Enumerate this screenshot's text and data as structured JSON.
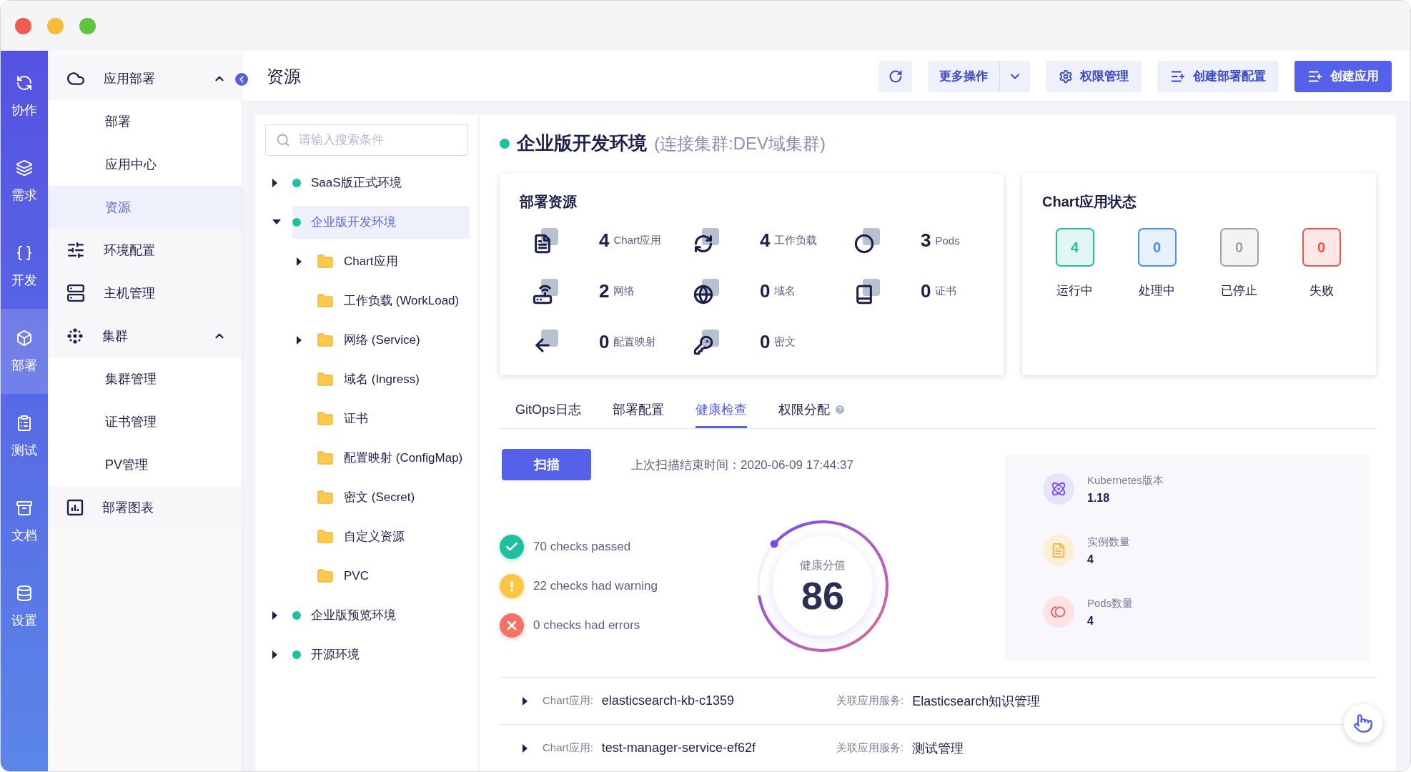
{
  "rail": {
    "items": [
      {
        "label": "协作",
        "selected": false
      },
      {
        "label": "需求",
        "selected": false
      },
      {
        "label": "开发",
        "selected": false
      },
      {
        "label": "部署",
        "selected": true
      },
      {
        "label": "测试",
        "selected": false
      },
      {
        "label": "文档",
        "selected": false
      },
      {
        "label": "设置",
        "selected": false
      }
    ]
  },
  "sidebar": {
    "items": [
      {
        "label": "应用部署",
        "selected": false,
        "expanded": true,
        "children": [
          {
            "label": "部署",
            "selected": false
          },
          {
            "label": "应用中心",
            "selected": false
          },
          {
            "label": "资源",
            "selected": true
          }
        ]
      },
      {
        "label": "环境配置",
        "selected": false
      },
      {
        "label": "主机管理",
        "selected": false
      },
      {
        "label": "集群",
        "selected": false,
        "expanded": true,
        "children": [
          {
            "label": "集群管理",
            "selected": false
          },
          {
            "label": "证书管理",
            "selected": false
          },
          {
            "label": "PV管理",
            "selected": false
          }
        ]
      },
      {
        "label": "部署图表",
        "selected": false
      }
    ]
  },
  "header": {
    "title": "资源",
    "buttons": [
      {
        "kind": "refresh"
      },
      {
        "kind": "dropdown",
        "label": "更多操作"
      },
      {
        "kind": "settings",
        "label": "权限管理"
      },
      {
        "kind": "create",
        "label": "创建部署配置"
      },
      {
        "kind": "primary",
        "label": "创建应用"
      }
    ]
  },
  "tree": {
    "search": {
      "placeholder": "请输入搜索条件"
    },
    "nodes": [
      {
        "label": "SaaS版正式环境",
        "selected": false,
        "expanded": false
      },
      {
        "label": "企业版开发环境",
        "selected": true,
        "expanded": true,
        "children": [
          {
            "label": "Chart应用",
            "selected": false,
            "expanded": false
          },
          {
            "label": "工作负载 (WorkLoad)",
            "selected": false
          },
          {
            "label": "网络 (Service)",
            "selected": false,
            "expanded": false
          },
          {
            "label": "域名 (Ingress)",
            "selected": false
          },
          {
            "label": "证书",
            "selected": false
          },
          {
            "label": "配置映射 (ConfigMap)",
            "selected": false
          },
          {
            "label": "密文 (Secret)",
            "selected": false
          },
          {
            "label": "自定义资源",
            "selected": false
          },
          {
            "label": "PVC",
            "selected": false
          }
        ]
      },
      {
        "label": "企业版预览环境",
        "selected": false,
        "expanded": false
      },
      {
        "label": "开源环境",
        "selected": false,
        "expanded": false
      }
    ]
  },
  "environment": {
    "name": "企业版开发环境",
    "cluster": "(连接集群:DEV域集群)"
  },
  "resources": {
    "title": "部署资源",
    "items": [
      {
        "count": "4",
        "label": "Chart应用"
      },
      {
        "count": "4",
        "label": "工作负载"
      },
      {
        "count": "3",
        "label": "Pods"
      },
      {
        "count": "2",
        "label": "网络"
      },
      {
        "count": "0",
        "label": "域名"
      },
      {
        "count": "0",
        "label": "证书"
      },
      {
        "count": "0",
        "label": "配置映射"
      },
      {
        "count": "0",
        "label": "密文"
      }
    ]
  },
  "chart_status": {
    "title": "Chart应用状态",
    "items": [
      {
        "count": "4",
        "label": "运行中",
        "color": "#1fbf9f"
      },
      {
        "count": "0",
        "label": "处理中",
        "color": "#4d8ff7"
      },
      {
        "count": "0",
        "label": "已停止",
        "color": "#a3a3a3"
      },
      {
        "count": "0",
        "label": "失败",
        "color": "#f2544b"
      }
    ]
  },
  "tabs": [
    {
      "label": "GitOps日志",
      "selected": false,
      "help": false
    },
    {
      "label": "部署配置",
      "selected": false,
      "help": false
    },
    {
      "label": "健康检查",
      "selected": true,
      "help": false
    },
    {
      "label": "权限分配",
      "selected": false,
      "help": true
    }
  ],
  "health": {
    "scan_button": "扫描",
    "last_scan": "上次扫描结束时间：2020-06-09 17:44:37",
    "checks": [
      {
        "kind": "pass",
        "text": "70 checks passed"
      },
      {
        "kind": "warning",
        "text": "22 checks had warning"
      },
      {
        "kind": "error",
        "text": "0 checks had errors"
      }
    ],
    "score": {
      "label": "健康分值",
      "value": "86"
    },
    "stats": [
      {
        "label": "Kubernetes版本",
        "value": "1.18"
      },
      {
        "label": "实例数量",
        "value": "4"
      },
      {
        "label": "Pods数量",
        "value": "4"
      }
    ]
  },
  "releases": [
    {
      "expanded": false,
      "chart_label": "Chart应用:",
      "chart": "elasticsearch-kb-c1359",
      "service_label": "关联应用服务:",
      "service": "Elasticsearch知识管理"
    },
    {
      "expanded": false,
      "chart_label": "Chart应用:",
      "chart": "test-manager-service-ef62f",
      "service_label": "关联应用服务:",
      "service": "测试管理"
    }
  ]
}
